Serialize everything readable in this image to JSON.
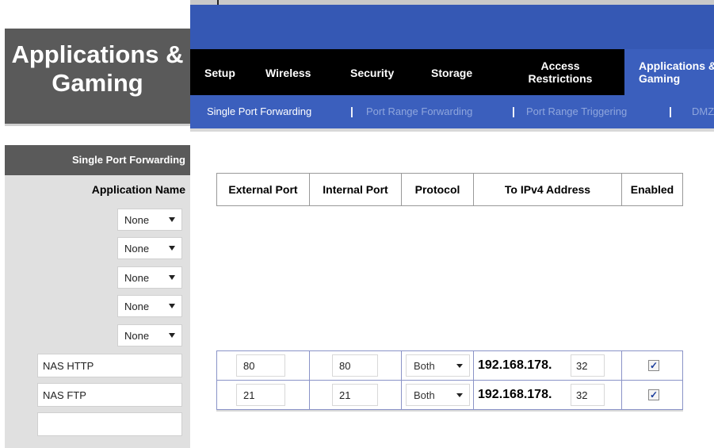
{
  "title": {
    "line1": "Applications &",
    "line2": "Gaming"
  },
  "tabs": [
    {
      "label": "Setup"
    },
    {
      "label": "Wireless"
    },
    {
      "label": "Security"
    },
    {
      "label": "Storage"
    },
    {
      "label": "Access Restrictions"
    },
    {
      "label": "Applications & Gaming"
    }
  ],
  "subtabs": [
    {
      "label": "Single Port Forwarding"
    },
    {
      "label": "Port Range Forwarding"
    },
    {
      "label": "Port Range Triggering"
    },
    {
      "label": "DMZ"
    }
  ],
  "sidebar": {
    "section_title": "Single Port Forwarding",
    "app_name_label": "Application Name",
    "presets": [
      "None",
      "None",
      "None",
      "None",
      "None"
    ],
    "custom_names": [
      "NAS HTTP",
      "NAS FTP",
      ""
    ]
  },
  "table": {
    "headers": [
      "External Port",
      "Internal Port",
      "Protocol",
      "To IPv4 Address",
      "Enabled"
    ],
    "rows": [
      {
        "external": "80",
        "internal": "80",
        "protocol": "Both",
        "ip_prefix": "192.168.178.",
        "ip_last": "32",
        "enabled": "✓"
      },
      {
        "external": "21",
        "internal": "21",
        "protocol": "Both",
        "ip_prefix": "192.168.178.",
        "ip_last": "32",
        "enabled": "✓"
      }
    ]
  },
  "colors": {
    "header_blue": "#3558b4",
    "dark_gray": "#5a5a5a",
    "black": "#000000"
  }
}
